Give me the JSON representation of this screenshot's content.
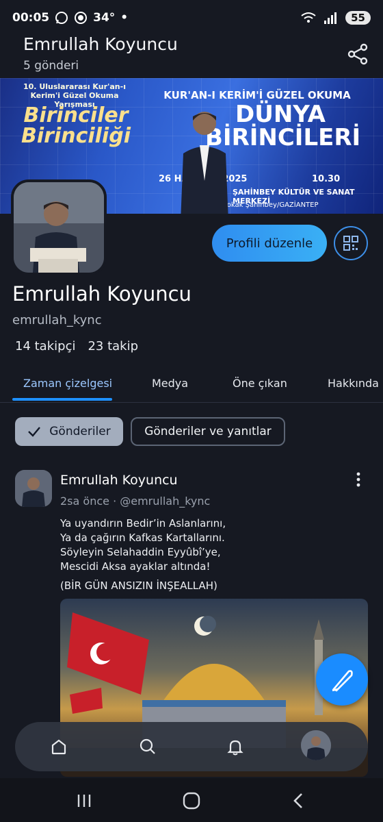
{
  "status_bar": {
    "time": "00:05",
    "temperature": "34°",
    "dot": "•",
    "battery": "55",
    "icons": [
      "whatsapp-icon",
      "sync-icon",
      "wifi-icon",
      "signal-icon"
    ]
  },
  "header": {
    "title": "Emrullah Koyuncu",
    "post_count": "5 gönderi",
    "share_icon": "share-icon"
  },
  "banner": {
    "line1": "10. Uluslararası Kur'an-ı Kerim'i Güzel Okuma Yarışması",
    "line2": "Birinciler Birinciliği",
    "line3": "KUR'AN-I KERİM'İ GÜZEL OKUMA",
    "line4": "DÜNYA BİRİNCİLERİ",
    "date": "26 HAZİRAN 2025",
    "time": "10.30",
    "venue": "ŞAHİNBEY KÜLTÜR VE SANAT MERKEZİ",
    "address": "247. Sokak Şahinbey/GAZİANTEP"
  },
  "profile": {
    "edit_label": "Profili düzenle",
    "qr_icon": "qr-code-icon",
    "display_name": "Emrullah Koyuncu",
    "handle": "emrullah_kync",
    "followers": "14 takipçi",
    "following": "23 takip"
  },
  "tabs": [
    {
      "label": "Zaman çizelgesi",
      "active": true
    },
    {
      "label": "Medya",
      "active": false
    },
    {
      "label": "Öne çıkan",
      "active": false
    },
    {
      "label": "Hakkında",
      "active": false
    }
  ],
  "filters": {
    "posts": "Gönderiler",
    "posts_and_replies": "Gönderiler ve yanıtlar"
  },
  "post": {
    "author": "Emrullah Koyuncu",
    "meta": "2sa önce · @emrullah_kync",
    "lines": [
      "Ya uyandırın Bedir’in Aslanlarını,",
      "Ya da çağırın Kafkas Kartallarını.",
      "Söyleyin Selahaddin Eyyûbî’ye,",
      "Mescidi Aksa ayaklar altında!"
    ],
    "footer": "(BİR GÜN ANSIZIN İNŞEALLAH)"
  },
  "fab": {
    "icon": "compose-icon"
  },
  "bottom_nav": {
    "items": [
      "home-icon",
      "search-icon",
      "notifications-icon",
      "profile-avatar"
    ]
  },
  "system_nav": {
    "items": [
      "recents-icon",
      "home-circle-icon",
      "back-icon"
    ]
  },
  "colors": {
    "background": "#161922",
    "accent": "#1e90ff",
    "edit_button": "#3ab0f5"
  }
}
